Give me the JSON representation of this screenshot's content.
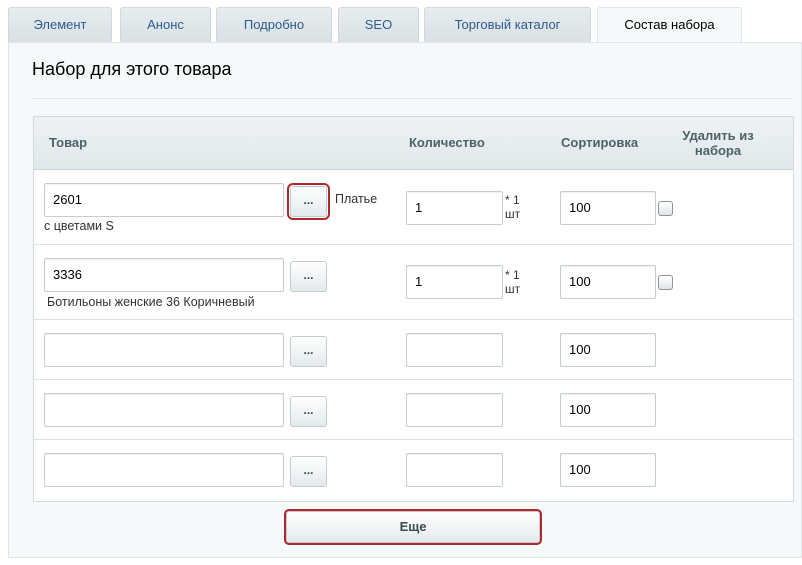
{
  "tabs": [
    {
      "label": "Элемент",
      "active": false
    },
    {
      "label": "Анонс",
      "active": false
    },
    {
      "label": "Подробно",
      "active": false
    },
    {
      "label": "SEO",
      "active": false
    },
    {
      "label": "Торговый каталог",
      "active": false
    },
    {
      "label": "Состав набора",
      "active": true
    }
  ],
  "panel": {
    "title": "Набор для этого товара"
  },
  "table": {
    "headers": {
      "product": "Товар",
      "quantity": "Количество",
      "sort": "Сортировка",
      "delete_line1": "Удалить из",
      "delete_line2": "набора"
    },
    "rows": [
      {
        "product_id": "2601",
        "product_name_part1": "Платье",
        "product_name_part2": "с цветами S",
        "quantity": "1",
        "unit_line1": "* 1",
        "unit_line2": "шт",
        "sort": "100",
        "has_checkbox": true,
        "delete_checked": false
      },
      {
        "product_id": "3336",
        "product_name": "Ботильоны женские 36 Коричневый",
        "quantity": "1",
        "unit_line1": "* 1",
        "unit_line2": "шт",
        "sort": "100",
        "has_checkbox": true,
        "delete_checked": false
      },
      {
        "product_id": "",
        "quantity": "",
        "sort": "100",
        "has_checkbox": false
      },
      {
        "product_id": "",
        "quantity": "",
        "sort": "100",
        "has_checkbox": false
      },
      {
        "product_id": "",
        "quantity": "",
        "sort": "100",
        "has_checkbox": false
      }
    ],
    "select_button_label": "..."
  },
  "more_button_label": "Еще",
  "colors": {
    "highlight_border": "#b0272c",
    "tab_text": "#2c5c8a",
    "panel_background": "#f5f9f9"
  }
}
